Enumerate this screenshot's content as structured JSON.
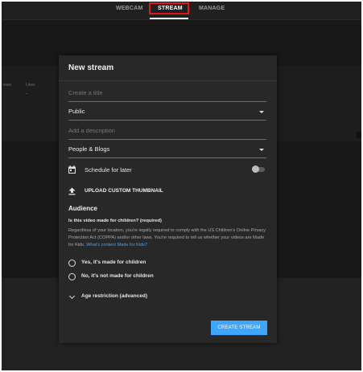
{
  "nav": {
    "tabs": [
      {
        "label": "WEBCAM"
      },
      {
        "label": "STREAM",
        "active": true
      },
      {
        "label": "MANAGE"
      }
    ]
  },
  "background": {
    "col_views": "iews",
    "col_likes": "Likes",
    "likes_value": "-"
  },
  "dialog": {
    "title": "New stream",
    "title_placeholder": "Create a title",
    "privacy_value": "Public",
    "description_placeholder": "Add a description",
    "category_value": "People & Blogs",
    "schedule_label": "Schedule for later",
    "schedule_enabled": false,
    "upload_label": "UPLOAD CUSTOM THUMBNAIL",
    "audience": {
      "heading": "Audience",
      "question": "Is this video made for children? (required)",
      "text": "Regardless of your location, you're legally required to comply with the US Children's Online Privacy Protection Act (COPPA) and/or other laws. You're required to tell us whether your videos are Made for Kids.",
      "link": "What's content Made for Kids?",
      "option_yes": "Yes, it's made for children",
      "option_no": "No, it's not made for children"
    },
    "age_restriction_label": "Age restriction (advanced)",
    "create_button": "CREATE STREAM"
  },
  "colors": {
    "accent": "#3ea6ff",
    "highlight": "#e01818",
    "dialog_bg": "#282828"
  },
  "icons": [
    "calendar-icon",
    "upload-icon",
    "chevron-down-icon",
    "dropdown-caret-icon"
  ]
}
